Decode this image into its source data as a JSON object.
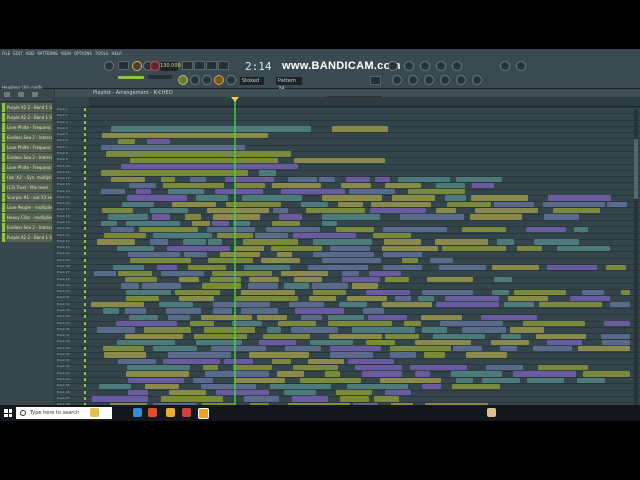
{
  "menu": [
    "FILE",
    "EDIT",
    "ADD",
    "PATTERNS",
    "VIEW",
    "OPTIONS",
    "TOOLS",
    "HELP"
  ],
  "toolbar": {
    "tempo": "130.000",
    "clock": "2:14",
    "bandicam": "www.BANDICAM.com",
    "pattern": "Pattern 24",
    "snap": "Stoked",
    "hint1": "Headless chin melfy",
    "hint2": "00:00:00"
  },
  "browser": {
    "channels": [
      "Purple X2 2 - Band 1 Sena",
      "Purple X2 2 - Band 1 Sena",
      "Love Philte - Frequenc",
      "Endless Sea 2 - Interval",
      "Love Philte - Frequenc",
      "Endless Sea 2 - Interval",
      "Love Philte - Frequency",
      "Fab 'X3' - Syn. multiplier",
      "(13) Trust - Mix level",
      "Scorpio #1 - out X3 Level",
      "Love People - multiplier",
      "Heavy Cliss - multiplier",
      "Endless Sea 2 - Interval",
      "Purple X2 2 - Band 1 Sena"
    ]
  },
  "playlist": {
    "title": "Playlist - Arrangement - K-CHEO",
    "recording": "Recording (HH:TT)",
    "tracks": [
      "Track 1",
      "Track 2",
      "Track 3",
      "Track 4",
      "Track 5",
      "Track 6",
      "Track 7",
      "Track 8",
      "Track 9",
      "Track 10",
      "Track 11",
      "Track 12",
      "Track 13",
      "Track 14",
      "Track 15",
      "Track 16",
      "Track 17",
      "Track 18",
      "Track 19",
      "Track 20",
      "Track 21",
      "Track 22",
      "Track 23",
      "Track 24",
      "Track 25",
      "Track 26",
      "Track 27",
      "Track 28",
      "Track 29",
      "Track 30",
      "Track 31",
      "Track 32",
      "Track 33",
      "Track 34",
      "Track 35",
      "Track 36",
      "Track 37",
      "Track 38",
      "Track 39",
      "Track 40",
      "Track 41",
      "Track 42",
      "Track 43",
      "Track 44",
      "Track 45",
      "Track 46",
      "Track 47",
      "Track 48",
      "Track 49",
      "Track 50"
    ]
  },
  "taskbar": {
    "search_placeholder": "Type here to search"
  },
  "colors": {
    "accent_green": "#8dc63f",
    "playhead": "#3fcf3f",
    "clip_purple": "#6a5aa0",
    "clip_olive": "#8a8a4a",
    "clip_teal": "#4d7a7a"
  }
}
